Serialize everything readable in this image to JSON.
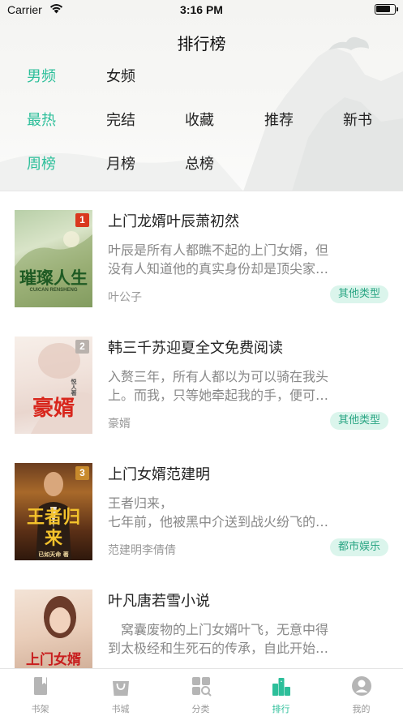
{
  "status_bar": {
    "carrier": "Carrier",
    "time": "3:16 PM"
  },
  "nav": {
    "title": "排行榜"
  },
  "filters": {
    "gender": [
      {
        "label": "男频",
        "active": true
      },
      {
        "label": "女频",
        "active": false
      }
    ],
    "sort": [
      {
        "label": "最热",
        "active": true
      },
      {
        "label": "完结",
        "active": false
      },
      {
        "label": "收藏",
        "active": false
      },
      {
        "label": "推荐",
        "active": false
      },
      {
        "label": "新书",
        "active": false
      }
    ],
    "period": [
      {
        "label": "周榜",
        "active": true
      },
      {
        "label": "月榜",
        "active": false
      },
      {
        "label": "总榜",
        "active": false
      }
    ]
  },
  "books": [
    {
      "rank": "1",
      "title": "上门龙婿叶辰萧初然",
      "desc": [
        "叶辰是所有人都瞧不起的上门女婿，但",
        "没有人知道他的真实身份却是顶尖家…"
      ],
      "author": "叶公子",
      "tag": "其他类型",
      "cover_text": "璀璨人生",
      "cover_sub": "CUICAN RENSHENG"
    },
    {
      "rank": "2",
      "title": "韩三千苏迎夏全文免费阅读",
      "desc": [
        "入赘三年，所有人都以为可以骑在我头",
        "上。而我，只等她牵起我的手，便可…"
      ],
      "author": "豪婿",
      "tag": "其他类型",
      "cover_text": "豪婿",
      "cover_sub": "悦人著"
    },
    {
      "rank": "3",
      "title": "上门女婿范建明",
      "desc": [
        "王者归来，",
        "七年前，他被黑中介送到战火纷飞的…"
      ],
      "author": "范建明李倩倩",
      "tag": "都市娱乐",
      "cover_text": "王者归来",
      "cover_sub": "已如天命 著"
    },
    {
      "rank": "",
      "title": "叶凡唐若雪小说",
      "desc": [
        "　窝囊废物的上门女婿叶飞，无意中得",
        "到太极经和生死石的传承，自此开始…"
      ],
      "author": "",
      "tag": "",
      "cover_text": "上门女婿",
      "cover_sub": ""
    }
  ],
  "tabbar": [
    {
      "label": "书架",
      "icon": "bookshelf-icon",
      "active": false
    },
    {
      "label": "书城",
      "icon": "shopping-bag-icon",
      "active": false
    },
    {
      "label": "分类",
      "icon": "category-grid-icon",
      "active": false
    },
    {
      "label": "排行",
      "icon": "ranking-icon",
      "active": true
    },
    {
      "label": "我的",
      "icon": "profile-icon",
      "active": false
    }
  ],
  "colors": {
    "accent": "#2dbf9a",
    "tag_bg": "#dbf5ec",
    "tag_text": "#2aa583",
    "rank_badge": "#d9381e"
  }
}
